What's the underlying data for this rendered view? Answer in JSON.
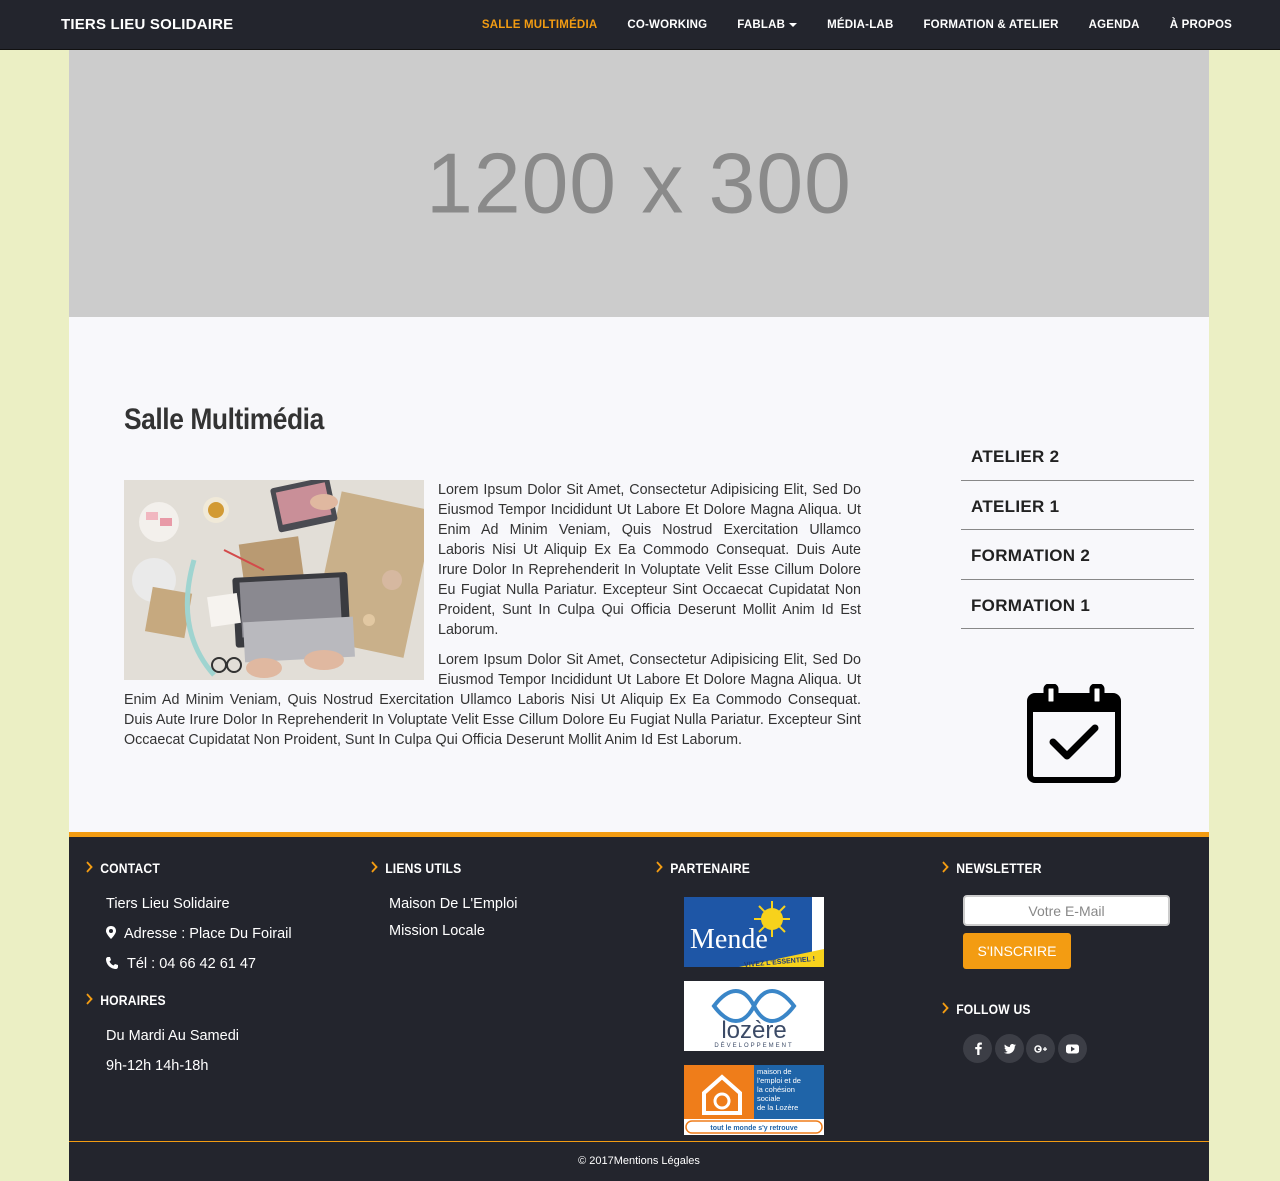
{
  "navbar": {
    "brand": "TIERS LIEU SOLIDAIRE",
    "items": [
      {
        "label": "SALLE MULTIMÉDIA",
        "active": true
      },
      {
        "label": "CO-WORKING"
      },
      {
        "label": "FABLAB"
      },
      {
        "label": "MÉDIA-LAB"
      },
      {
        "label": "FORMATION & ATELIER"
      },
      {
        "label": "AGENDA"
      },
      {
        "label": "À PROPOS"
      }
    ]
  },
  "hero": {
    "placeholder_text": "1200 x 300"
  },
  "main": {
    "title": "Salle Multimédia",
    "paragraphs": [
      "Lorem Ipsum Dolor Sit Amet, Consectetur Adipisicing Elit, Sed Do Eiusmod Tempor Incididunt Ut Labore Et Dolore Magna Aliqua. Ut Enim Ad Minim Veniam, Quis Nostrud Exercitation Ullamco Laboris Nisi Ut Aliquip Ex Ea Commodo Consequat. Duis Aute Irure Dolor In Reprehenderit In Voluptate Velit Esse Cillum Dolore Eu Fugiat Nulla Pariatur. Excepteur Sint Occaecat Cupidatat Non Proident, Sunt In Culpa Qui Officia Deserunt Mollit Anim Id Est Laborum.",
      "Lorem Ipsum Dolor Sit Amet, Consectetur Adipisicing Elit, Sed Do Eiusmod Tempor Incididunt Ut Labore Et Dolore Magna Aliqua. Ut Enim Ad Minim Veniam, Quis Nostrud Exercitation Ullamco Laboris Nisi Ut Aliquip Ex Ea Commodo Consequat. Duis Aute Irure Dolor In Reprehenderit In Voluptate Velit Esse Cillum Dolore Eu Fugiat Nulla Pariatur. Excepteur Sint Occaecat Cupidatat Non Proident, Sunt In Culpa Qui Officia Deserunt Mollit Anim Id Est Laborum."
    ]
  },
  "sidebar": {
    "items": [
      {
        "label": "ATELIER 2"
      },
      {
        "label": "ATELIER 1"
      },
      {
        "label": "FORMATION 2"
      },
      {
        "label": "FORMATION 1"
      }
    ],
    "icon": "calendar-check-icon"
  },
  "footer": {
    "contact": {
      "heading": "CONTACT",
      "name": "Tiers Lieu Solidaire",
      "address": "Adresse : Place Du Foirail",
      "phone": "Tél : 04 66 42 61 47"
    },
    "horaires": {
      "heading": "HORAIRES",
      "days": "Du Mardi Au Samedi",
      "hours": "9h-12h 14h-18h"
    },
    "links": {
      "heading": "LIENS UTILS",
      "items": [
        "Maison De L'Emploi",
        "Mission Locale"
      ]
    },
    "partners": {
      "heading": "PARTENAIRE",
      "mende": {
        "name": "Mende",
        "tagline": "VIVEZ L'ESSENTIEL !"
      },
      "lozere": {
        "name": "lozère",
        "sub": "DÉVELOPPEMENT"
      },
      "maison": {
        "lines": [
          "maison de",
          "l'emploi et de",
          "la cohésion",
          "sociale",
          "de la Lozère"
        ],
        "tagline": "tout le monde s'y retrouve"
      }
    },
    "newsletter": {
      "heading": "NEWSLETTER",
      "placeholder": "Votre E-Mail",
      "button": "S'INSCRIRE"
    },
    "follow": {
      "heading": "FOLLOW US",
      "icons": [
        "facebook-icon",
        "twitter-icon",
        "google-plus-icon",
        "youtube-icon"
      ]
    },
    "copyright": "© 2017Mentions Légales"
  },
  "colors": {
    "accent": "#f39c12",
    "navbar_bg": "#23252d",
    "page_bg": "#ebefc4",
    "content_bg": "#f8f8fb"
  }
}
